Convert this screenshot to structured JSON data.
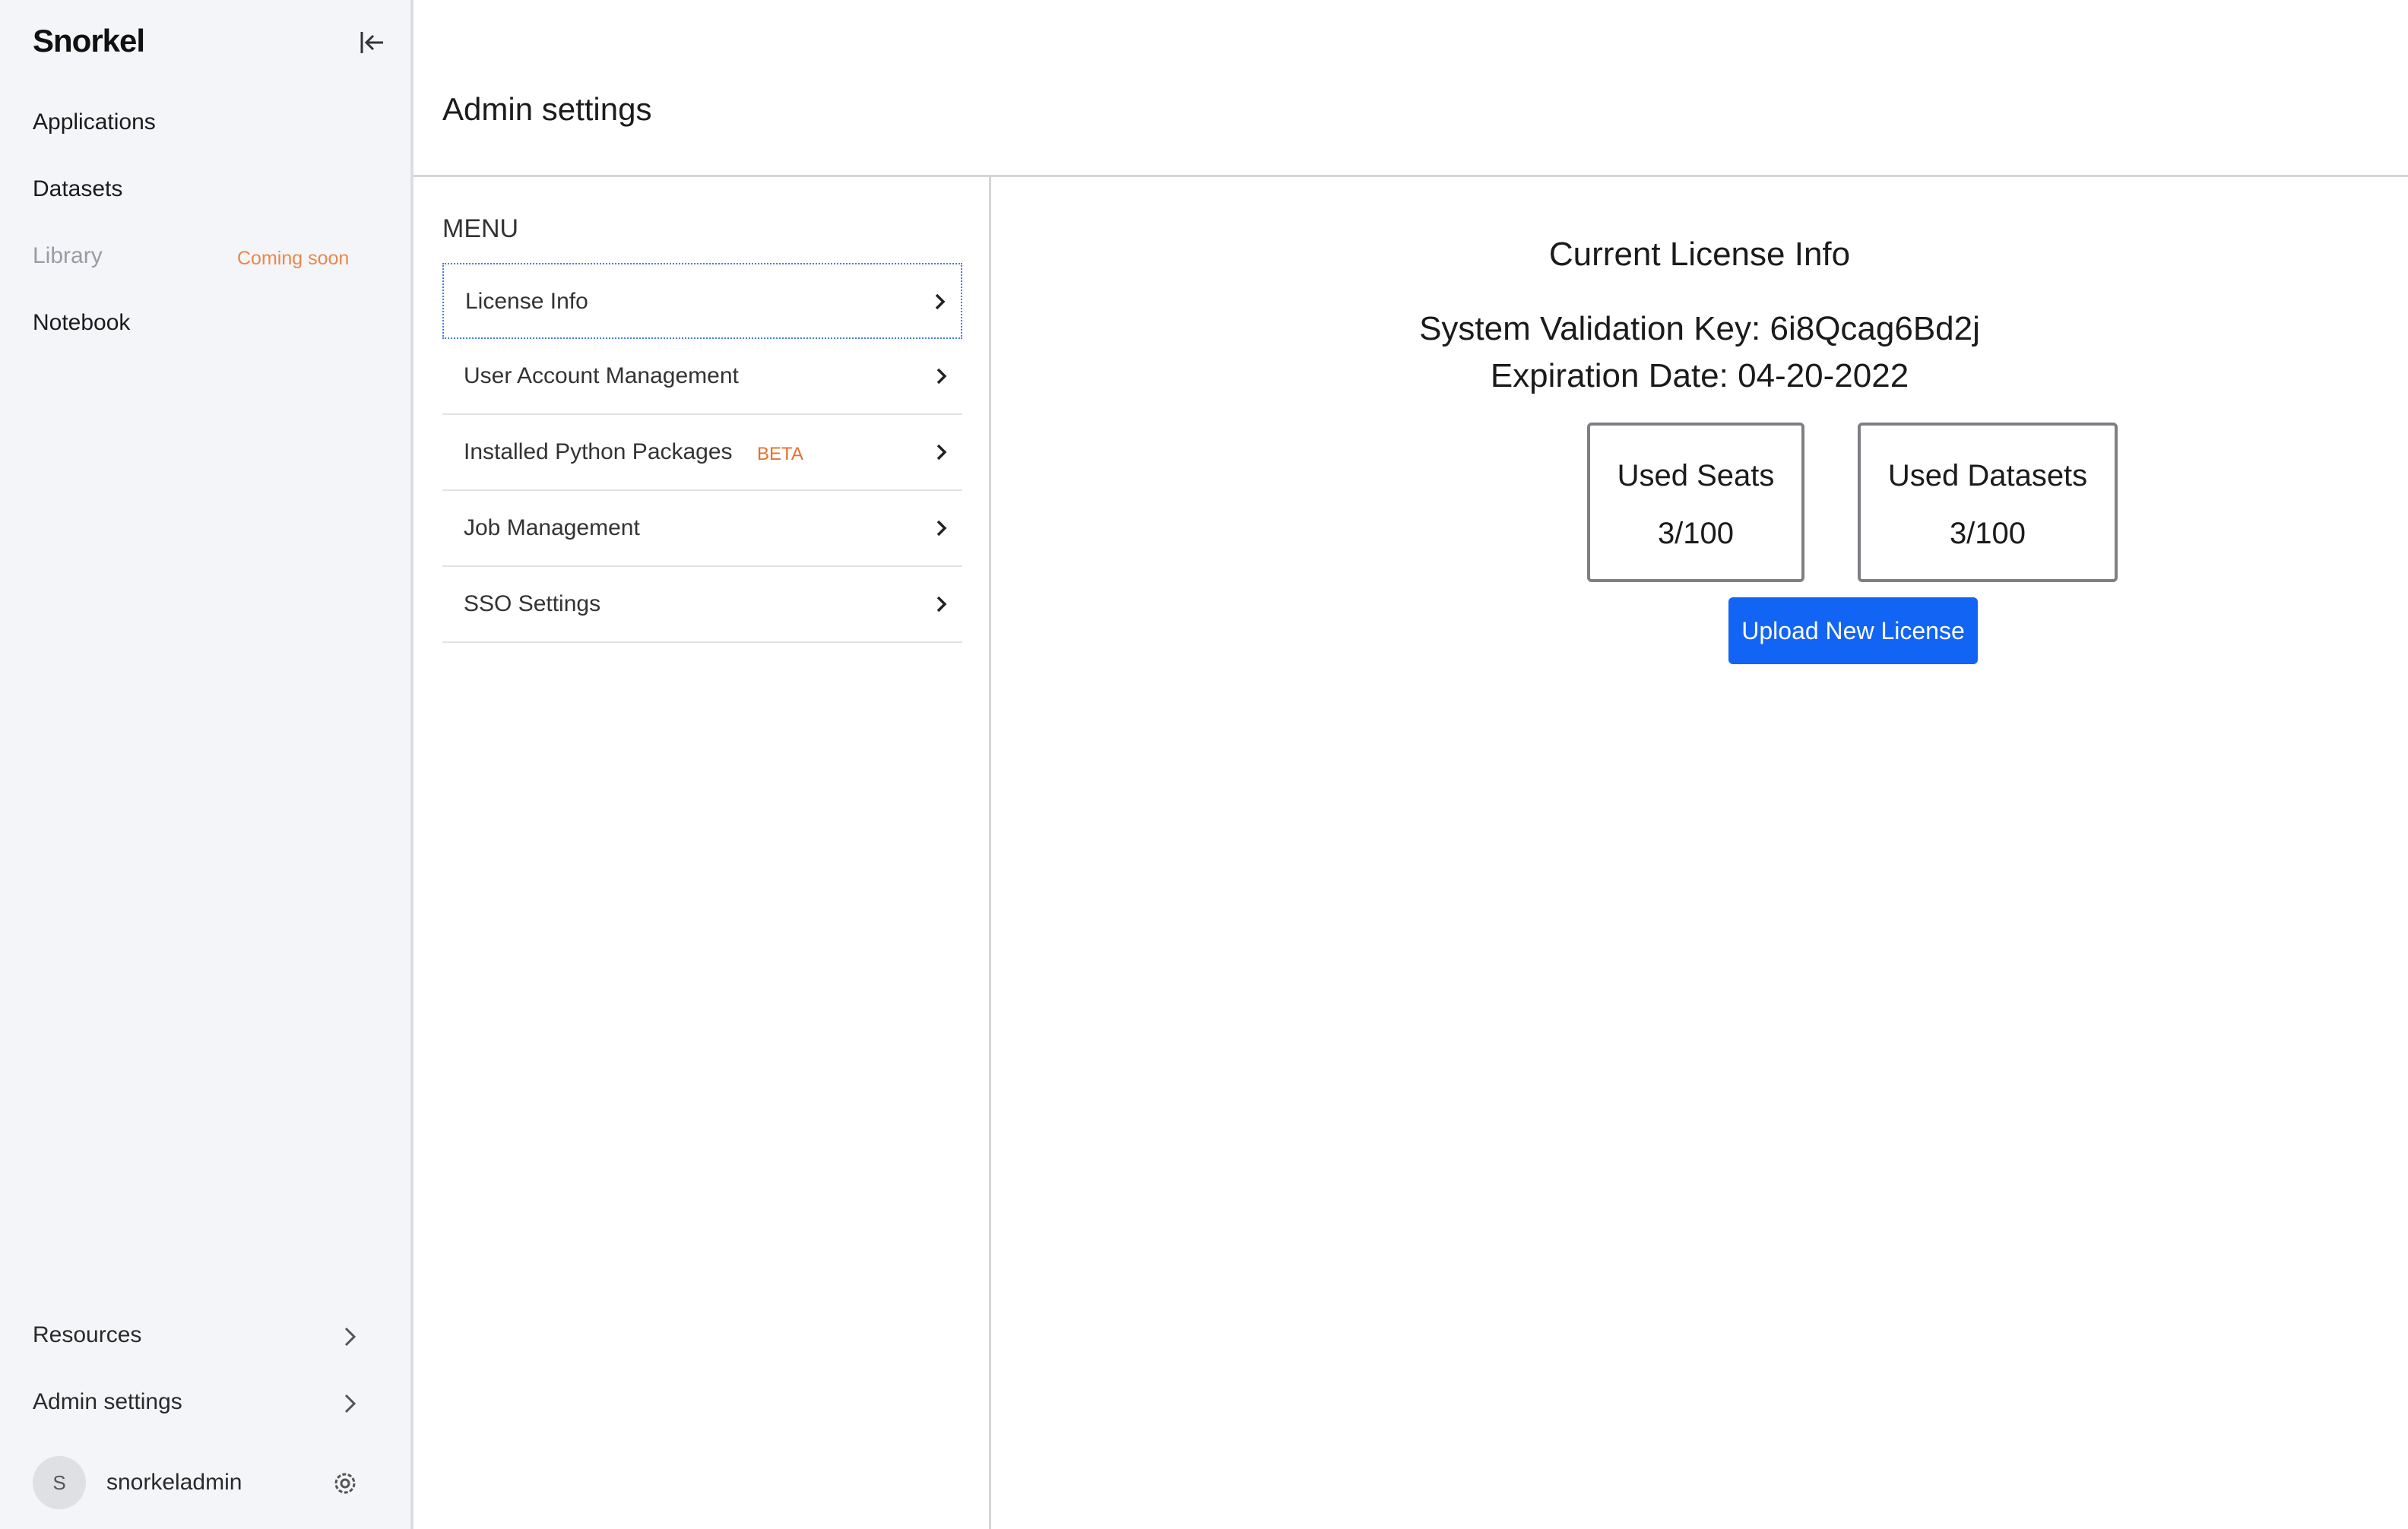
{
  "sidebar": {
    "logo": "Snorkel",
    "items": [
      {
        "label": "Applications"
      },
      {
        "label": "Datasets"
      },
      {
        "label": "Library",
        "badge": "Coming soon"
      },
      {
        "label": "Notebook"
      }
    ],
    "bottom": [
      {
        "label": "Resources"
      },
      {
        "label": "Admin settings"
      }
    ],
    "user": {
      "initial": "S",
      "name": "snorkeladmin"
    }
  },
  "header": {
    "title": "Admin settings"
  },
  "menu": {
    "title": "MENU",
    "items": [
      {
        "label": "License Info"
      },
      {
        "label": "User Account Management"
      },
      {
        "label": "Installed Python Packages",
        "badge": "BETA"
      },
      {
        "label": "Job Management"
      },
      {
        "label": "SSO Settings"
      }
    ]
  },
  "license": {
    "title": "Current License Info",
    "validation_key": "System Validation Key: 6i8Qcag6Bd2j",
    "expiration": "Expiration Date: 04-20-2022",
    "seats_label": "Used Seats",
    "seats_value": "3/100",
    "datasets_label": "Used Datasets",
    "datasets_value": "3/100",
    "upload_label": "Upload New License"
  },
  "colors": {
    "accent": "#1264f5",
    "badge": "#e8702a",
    "sidebar_bg": "#f4f5f8"
  }
}
